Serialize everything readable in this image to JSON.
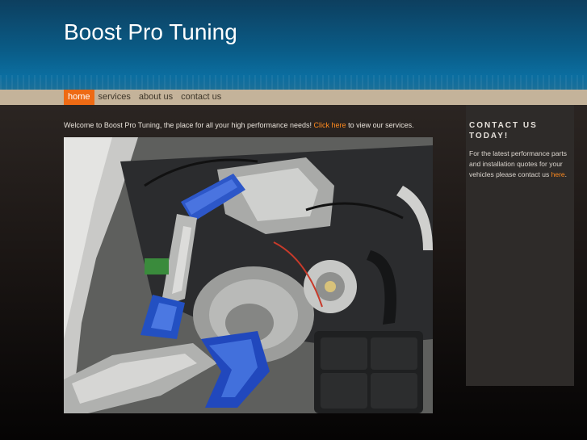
{
  "site": {
    "title": "Boost Pro Tuning"
  },
  "nav": {
    "items": [
      {
        "label": "home"
      },
      {
        "label": "services"
      },
      {
        "label": "about us"
      },
      {
        "label": "contact us"
      }
    ],
    "active": "home"
  },
  "main": {
    "welcome_text": "Welcome to Boost Pro Tuning, the place for all your high performance needs!",
    "welcome_link": "Click here",
    "welcome_suffix": "to view our services."
  },
  "sidebar": {
    "heading": "CONTACT US TODAY!",
    "body": "For the latest performance parts and installation quotes for your vehicles please contact us",
    "link": "here",
    "end": "."
  },
  "colors": {
    "accent": "#ee6a14",
    "link": "#ff8a1e",
    "nav_bar": "#c4b39a",
    "header_blue": "#0a5b86"
  }
}
